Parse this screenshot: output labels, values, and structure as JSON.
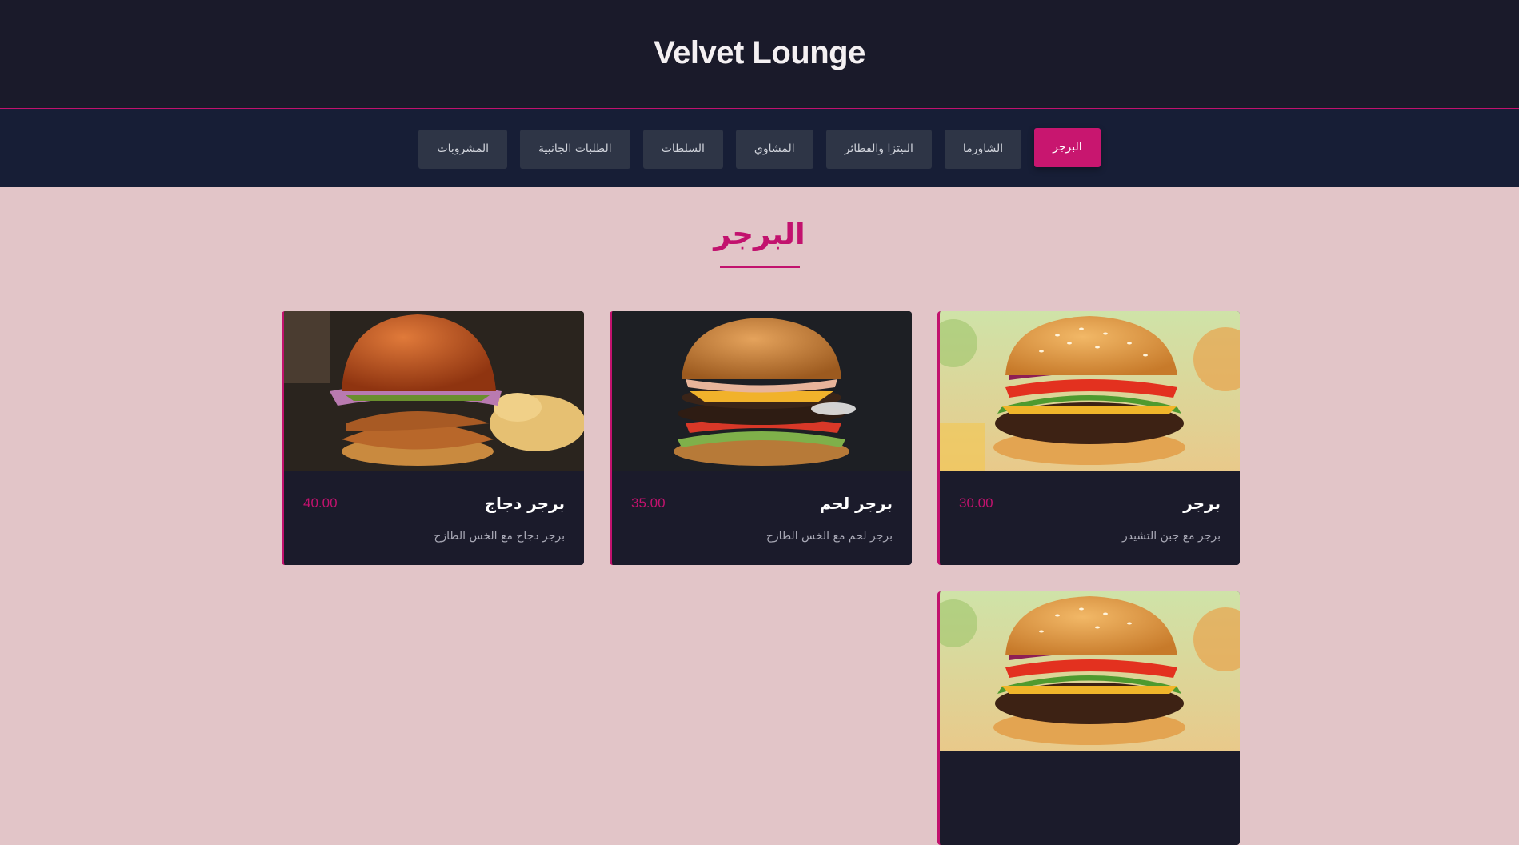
{
  "header": {
    "title": "Velvet Lounge"
  },
  "nav": {
    "items": [
      {
        "label": "البرجر",
        "active": true
      },
      {
        "label": "الشاورما",
        "active": false
      },
      {
        "label": "البيتزا والفطائر",
        "active": false
      },
      {
        "label": "المشاوي",
        "active": false
      },
      {
        "label": "السلطات",
        "active": false
      },
      {
        "label": "الطلبات الجانبية",
        "active": false
      },
      {
        "label": "المشروبات",
        "active": false
      }
    ]
  },
  "section": {
    "title": "البرجر"
  },
  "menu": {
    "items": [
      {
        "name": "برجر",
        "price": "30.00",
        "description": "برجر مع جبن التشيدر",
        "image": "beef-burger-photo"
      },
      {
        "name": "برجر لحم",
        "price": "35.00",
        "description": "برجر لحم مع الخس الطازج",
        "image": "double-beef-burger-photo"
      },
      {
        "name": "برجر دجاج",
        "price": "40.00",
        "description": "برجر دجاج مع الخس الطازج",
        "image": "chicken-burger-photo"
      },
      {
        "name": "",
        "price": "",
        "description": "",
        "image": "beef-burger-photo"
      }
    ]
  },
  "colors": {
    "accent": "#c2126e",
    "header_bg": "#1a1a2a",
    "nav_bg": "#171e36",
    "page_bg": "#e2c5c8",
    "card_bg": "#1b1b2b"
  }
}
